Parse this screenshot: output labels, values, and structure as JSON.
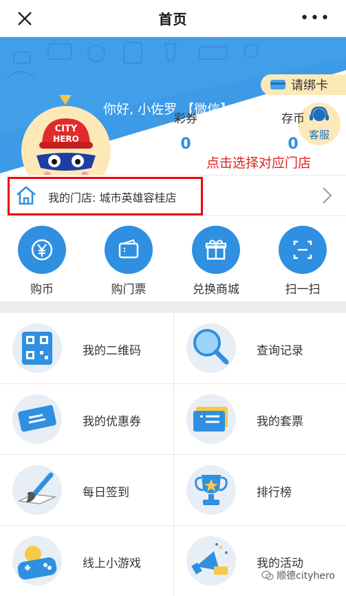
{
  "topbar": {
    "title": "首页",
    "more": "•••"
  },
  "hero": {
    "bind_card_label": "请绑卡",
    "greeting": "你好, 小佐罗 【微信】",
    "service_label": "客服",
    "avatar_text_1": "CITY",
    "avatar_text_2": "HERO",
    "stats": [
      {
        "label": "彩券",
        "value": "0"
      },
      {
        "label": "存币",
        "value": "0"
      }
    ],
    "hint": "点击选择对应门店"
  },
  "store": {
    "label": "我的门店: 城市英雄容桂店"
  },
  "quick_actions": [
    {
      "label": "购币",
      "icon": "coin-yen-icon"
    },
    {
      "label": "购门票",
      "icon": "ticket-wallet-icon"
    },
    {
      "label": "兑换商城",
      "icon": "gift-icon"
    },
    {
      "label": "扫一扫",
      "icon": "scan-icon"
    }
  ],
  "grid": [
    {
      "label": "我的二维码",
      "icon": "qr-code-icon"
    },
    {
      "label": "查询记录",
      "icon": "magnifier-icon"
    },
    {
      "label": "我的优惠券",
      "icon": "coupon-icon"
    },
    {
      "label": "我的套票",
      "icon": "package-ticket-icon"
    },
    {
      "label": "每日签到",
      "icon": "brush-checkin-icon"
    },
    {
      "label": "排行榜",
      "icon": "trophy-icon"
    },
    {
      "label": "线上小游戏",
      "icon": "gamepad-icon"
    },
    {
      "label": "我的活动",
      "icon": "megaphone-icon"
    }
  ],
  "watermark": "顺德cityhero",
  "colors": {
    "primary": "#2f8fe0",
    "accent_red": "#e02020",
    "cream": "#fde9b8"
  }
}
